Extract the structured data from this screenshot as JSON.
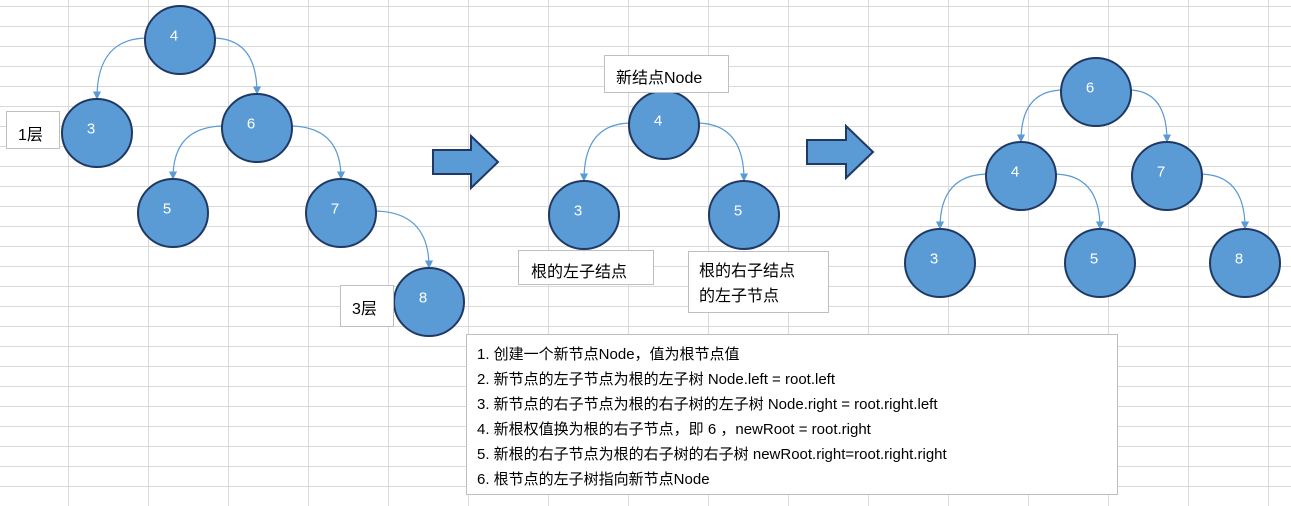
{
  "trees": {
    "original": {
      "nodes": [
        {
          "id": "o4",
          "label": "4"
        },
        {
          "id": "o3",
          "label": "3"
        },
        {
          "id": "o6",
          "label": "6"
        },
        {
          "id": "o5",
          "label": "5"
        },
        {
          "id": "o7",
          "label": "7"
        },
        {
          "id": "o8",
          "label": "8"
        }
      ],
      "edges": [
        [
          "o4",
          "o3"
        ],
        [
          "o4",
          "o6"
        ],
        [
          "o6",
          "o5"
        ],
        [
          "o6",
          "o7"
        ],
        [
          "o7",
          "o8"
        ]
      ]
    },
    "middle": {
      "nodes": [
        {
          "id": "m4",
          "label": "4"
        },
        {
          "id": "m3",
          "label": "3"
        },
        {
          "id": "m5",
          "label": "5"
        }
      ],
      "edges": [
        [
          "m4",
          "m3"
        ],
        [
          "m4",
          "m5"
        ]
      ]
    },
    "result": {
      "nodes": [
        {
          "id": "r6",
          "label": "6"
        },
        {
          "id": "r4",
          "label": "4"
        },
        {
          "id": "r7",
          "label": "7"
        },
        {
          "id": "r3",
          "label": "3"
        },
        {
          "id": "r5",
          "label": "5"
        },
        {
          "id": "r8",
          "label": "8"
        }
      ],
      "edges": [
        [
          "r6",
          "r4"
        ],
        [
          "r6",
          "r7"
        ],
        [
          "r4",
          "r3"
        ],
        [
          "r4",
          "r5"
        ],
        [
          "r7",
          "r8"
        ]
      ]
    }
  },
  "labels": {
    "layer1": "1层",
    "layer3": "3层",
    "new_node": "新结点Node",
    "root_left": "根的左子结点",
    "root_right_left_line1": "根的右子结点",
    "root_right_left_line2": "的左子节点"
  },
  "steps": [
    "1. 创建一个新节点Node，值为根节点值",
    "2. 新节点的左子节点为根的左子树  Node.left = root.left",
    "3. 新节点的右子节点为根的右子树的左子树 Node.right = root.right.left",
    "4. 新根权值换为根的右子节点，即 6 ，newRoot = root.right",
    "5. 新根的右子节点为根的右子树的右子树 newRoot.right=root.right.right",
    "6. 根节点的左子树指向新节点Node"
  ],
  "colors": {
    "node_fill": "#5b9bd5",
    "node_stroke": "#1f3864",
    "edge": "#5b9bd5",
    "arrow_fill": "#5b9bd5",
    "arrow_stroke": "#203864"
  }
}
